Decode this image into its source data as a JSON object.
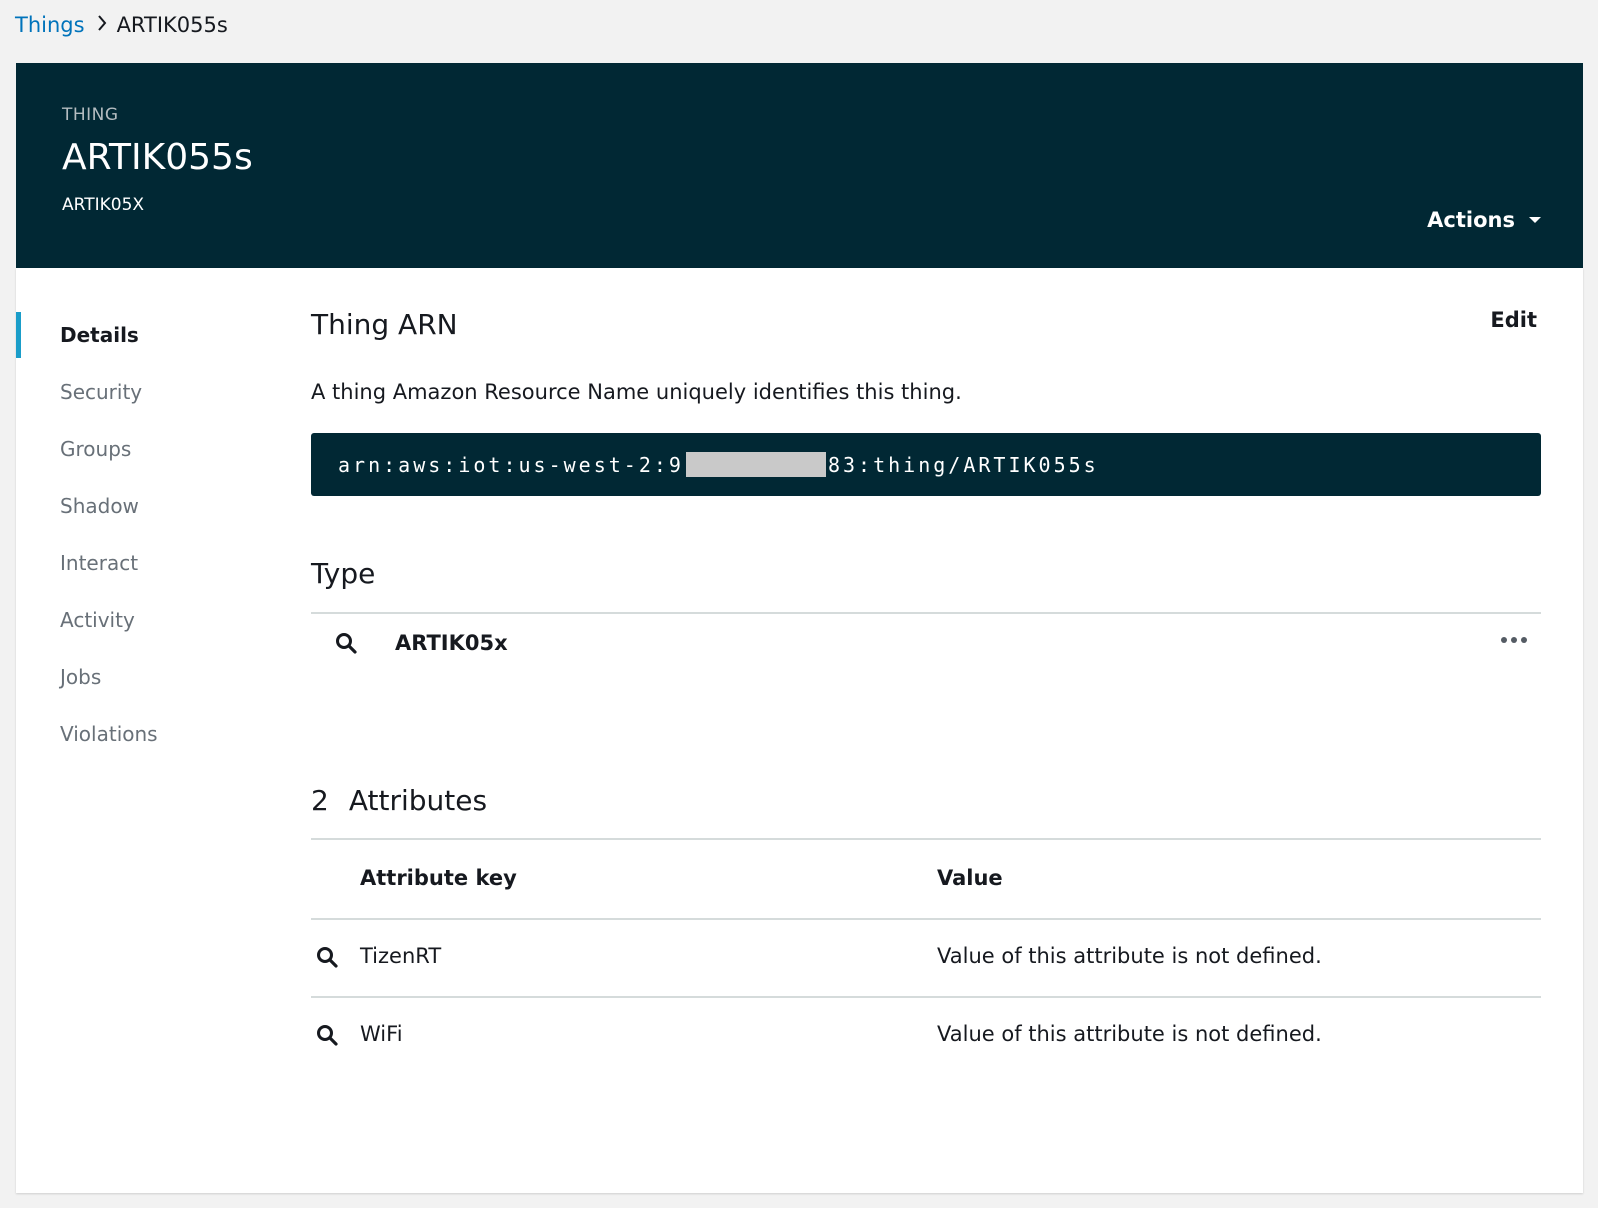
{
  "breadcrumb": {
    "parent": "Things",
    "current": "ARTIK055s"
  },
  "header": {
    "eyebrow": "THING",
    "title": "ARTIK055s",
    "subtitle": "ARTIK05X",
    "actions_label": "Actions"
  },
  "nav": {
    "items": [
      {
        "label": "Details",
        "active": true
      },
      {
        "label": "Security"
      },
      {
        "label": "Groups"
      },
      {
        "label": "Shadow"
      },
      {
        "label": "Interact"
      },
      {
        "label": "Activity"
      },
      {
        "label": "Jobs"
      },
      {
        "label": "Violations"
      }
    ]
  },
  "arn": {
    "title": "Thing ARN",
    "edit_label": "Edit",
    "description": "A thing Amazon Resource Name uniquely identifies this thing.",
    "value_prefix": "arn:aws:iot:us-west-2:9",
    "value_suffix": "83:thing/ARTIK055s"
  },
  "type": {
    "title": "Type",
    "name": "ARTIK05x"
  },
  "attributes": {
    "count": "2",
    "title": "Attributes",
    "columns": {
      "key": "Attribute key",
      "value": "Value"
    },
    "rows": [
      {
        "key": "TizenRT",
        "value": "Value of this attribute is not defined."
      },
      {
        "key": "WiFi",
        "value": "Value of this attribute is not defined."
      }
    ]
  },
  "colors": {
    "header_bg": "#012834",
    "link": "#0073bb",
    "active_accent": "#1a9dc9"
  }
}
